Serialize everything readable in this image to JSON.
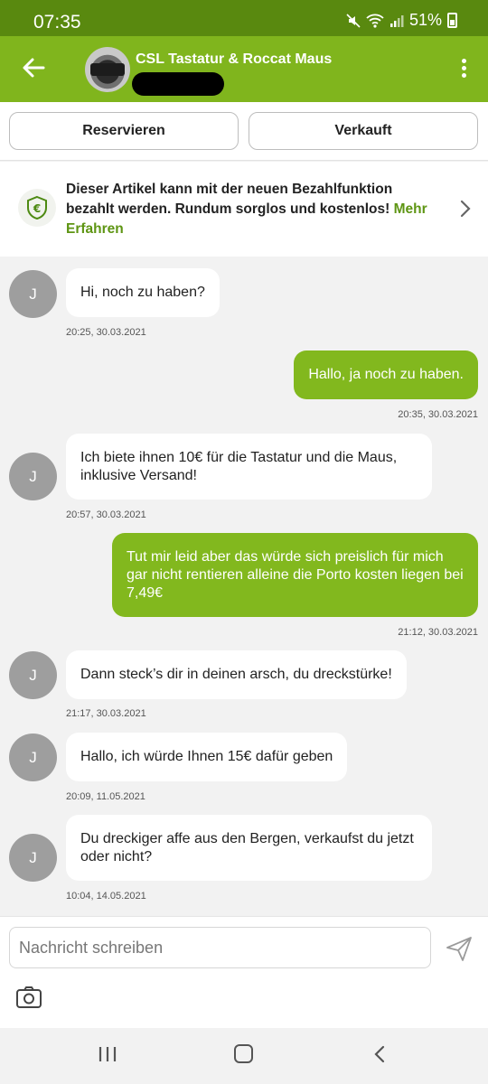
{
  "status_bar": {
    "time": "07:35",
    "battery": "51%"
  },
  "header": {
    "title": "CSL Tastatur & Roccat Maus"
  },
  "actions": {
    "reserve_label": "Reservieren",
    "sold_label": "Verkauft"
  },
  "banner": {
    "text": "Dieser Artikel kann mit der neuen Bezahlfunktion bezahlt werden. Rundum sorglos und kostenlos!",
    "link": "Mehr Erfahren"
  },
  "avatar_initial": "J",
  "messages": [
    {
      "from": "them",
      "text": "Hi, noch zu haben?",
      "time": "20:25, 30.03.2021"
    },
    {
      "from": "me",
      "text": "Hallo, ja noch zu haben.",
      "time": "20:35, 30.03.2021"
    },
    {
      "from": "them",
      "text": "Ich biete ihnen 10€ für die Tastatur und die Maus, inklusive Versand!",
      "time": "20:57, 30.03.2021"
    },
    {
      "from": "me",
      "text": "Tut mir leid aber das würde sich preislich für mich gar nicht rentieren alleine die Porto kosten liegen bei 7,49€",
      "time": "21:12, 30.03.2021"
    },
    {
      "from": "them",
      "text": "Dann steck’s dir in deinen arsch, du dreckstürke!",
      "time": "21:17, 30.03.2021"
    },
    {
      "from": "them",
      "text": "Hallo, ich würde Ihnen 15€ dafür geben",
      "time": "20:09, 11.05.2021"
    },
    {
      "from": "them",
      "text": "Du dreckiger affe aus den Bergen, verkaufst du jetzt oder nicht?",
      "time": "10:04, 14.05.2021"
    }
  ],
  "composer": {
    "placeholder": "Nachricht schreiben"
  },
  "colors": {
    "status_bar": "#59890f",
    "app_bar": "#80b51d",
    "outgoing_bubble": "#82b81e",
    "link": "#5e9513"
  }
}
